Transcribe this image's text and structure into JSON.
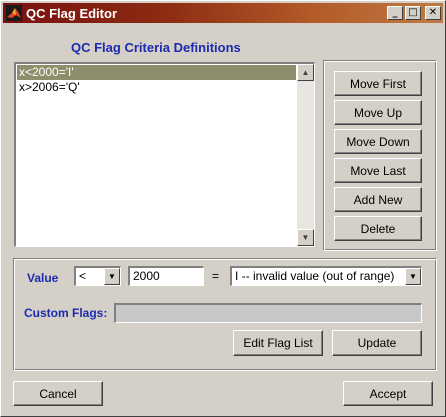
{
  "window": {
    "title": "QC Flag Editor"
  },
  "titlebar": {
    "minimize": "_",
    "maximize": "□",
    "close": "✕"
  },
  "header": {
    "title": "QC Flag Criteria Definitions"
  },
  "criteria_list": {
    "items": [
      "x<2000='I'",
      "x>2006='Q'"
    ],
    "selected_index": 0
  },
  "side_buttons": {
    "move_first": "Move First",
    "move_up": "Move Up",
    "move_down": "Move Down",
    "move_last": "Move Last",
    "add_new": "Add New",
    "delete": "Delete"
  },
  "editor": {
    "value_label": "Value",
    "operator": "<",
    "value": "2000",
    "equals": "=",
    "flag": "I -- invalid value (out of range)",
    "custom_flags_label": "Custom Flags:",
    "custom_flags_value": "",
    "edit_flag_list": "Edit Flag List",
    "update": "Update"
  },
  "footer": {
    "cancel": "Cancel",
    "accept": "Accept"
  },
  "icons": {
    "app": "matlab-icon",
    "scroll_up": "triangle-up-icon",
    "scroll_down": "triangle-down-icon",
    "dropdown": "triangle-down-icon"
  },
  "colors": {
    "titlebar_start": "#7a1010",
    "titlebar_end": "#c07a44",
    "label_blue": "#1d2ab0",
    "selection": "#8e8e6c",
    "face": "#d4d0c8"
  }
}
